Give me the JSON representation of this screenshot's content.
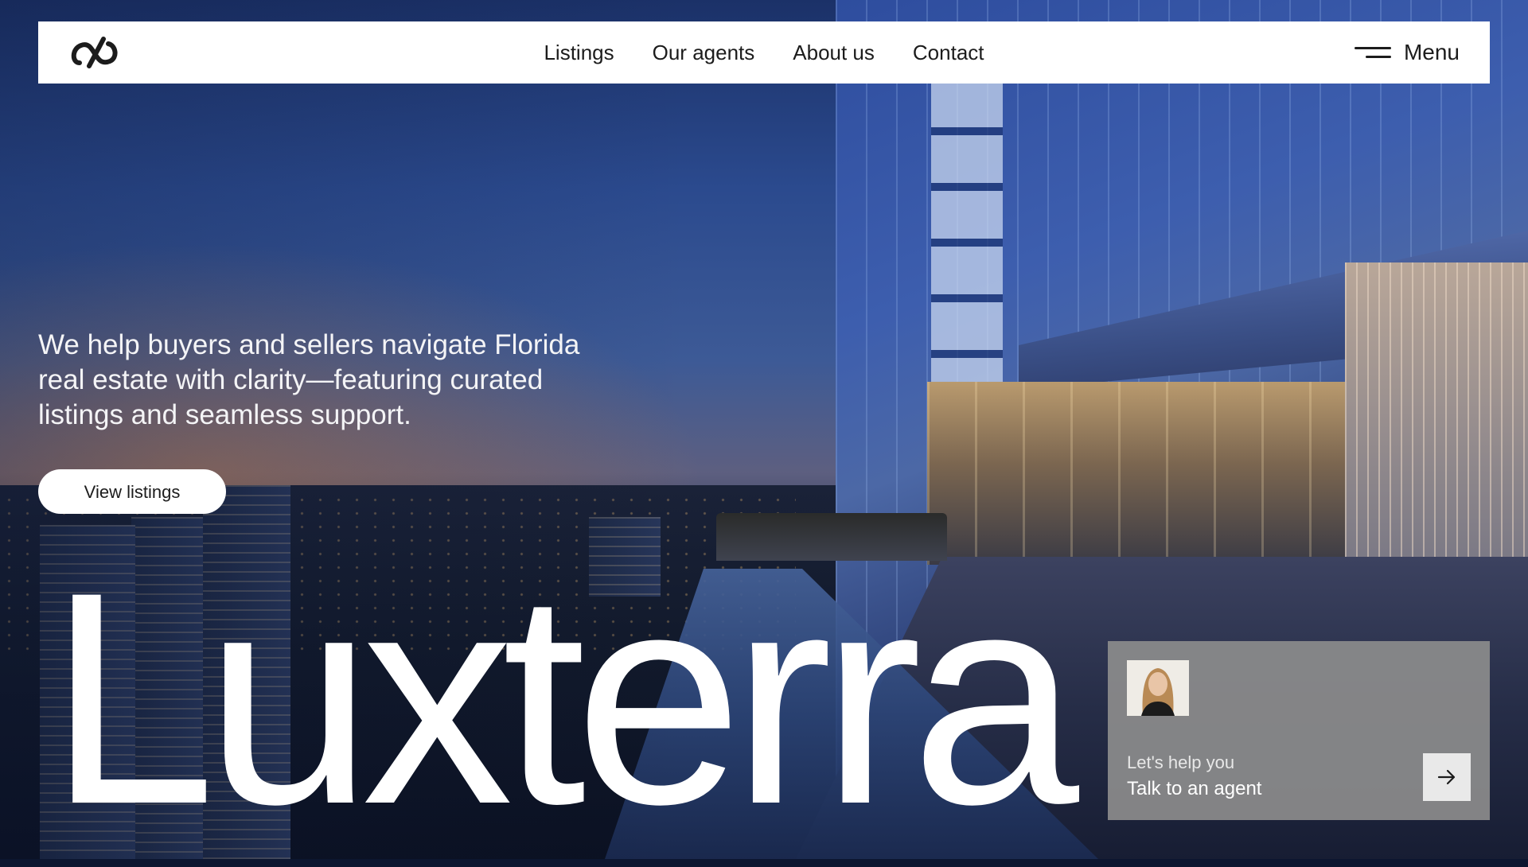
{
  "nav": {
    "links": [
      {
        "label": "Listings"
      },
      {
        "label": "Our agents"
      },
      {
        "label": "About us"
      },
      {
        "label": "Contact"
      }
    ],
    "menu_label": "Menu"
  },
  "hero": {
    "tagline": "We help buyers and sellers navigate Florida real estate with clarity—featuring curated listings and seamless support.",
    "cta_label": "View listings",
    "wordmark": "Luxterra"
  },
  "agent_card": {
    "subtitle": "Let's help you",
    "title": "Talk to an agent"
  },
  "icons": {
    "logo": "infinity-link-logo",
    "menu": "hamburger-menu-icon",
    "arrow": "arrow-right-icon"
  },
  "colors": {
    "nav_background": "#ffffff",
    "text_light": "#ffffff",
    "card_background": "#8c8c8c"
  }
}
